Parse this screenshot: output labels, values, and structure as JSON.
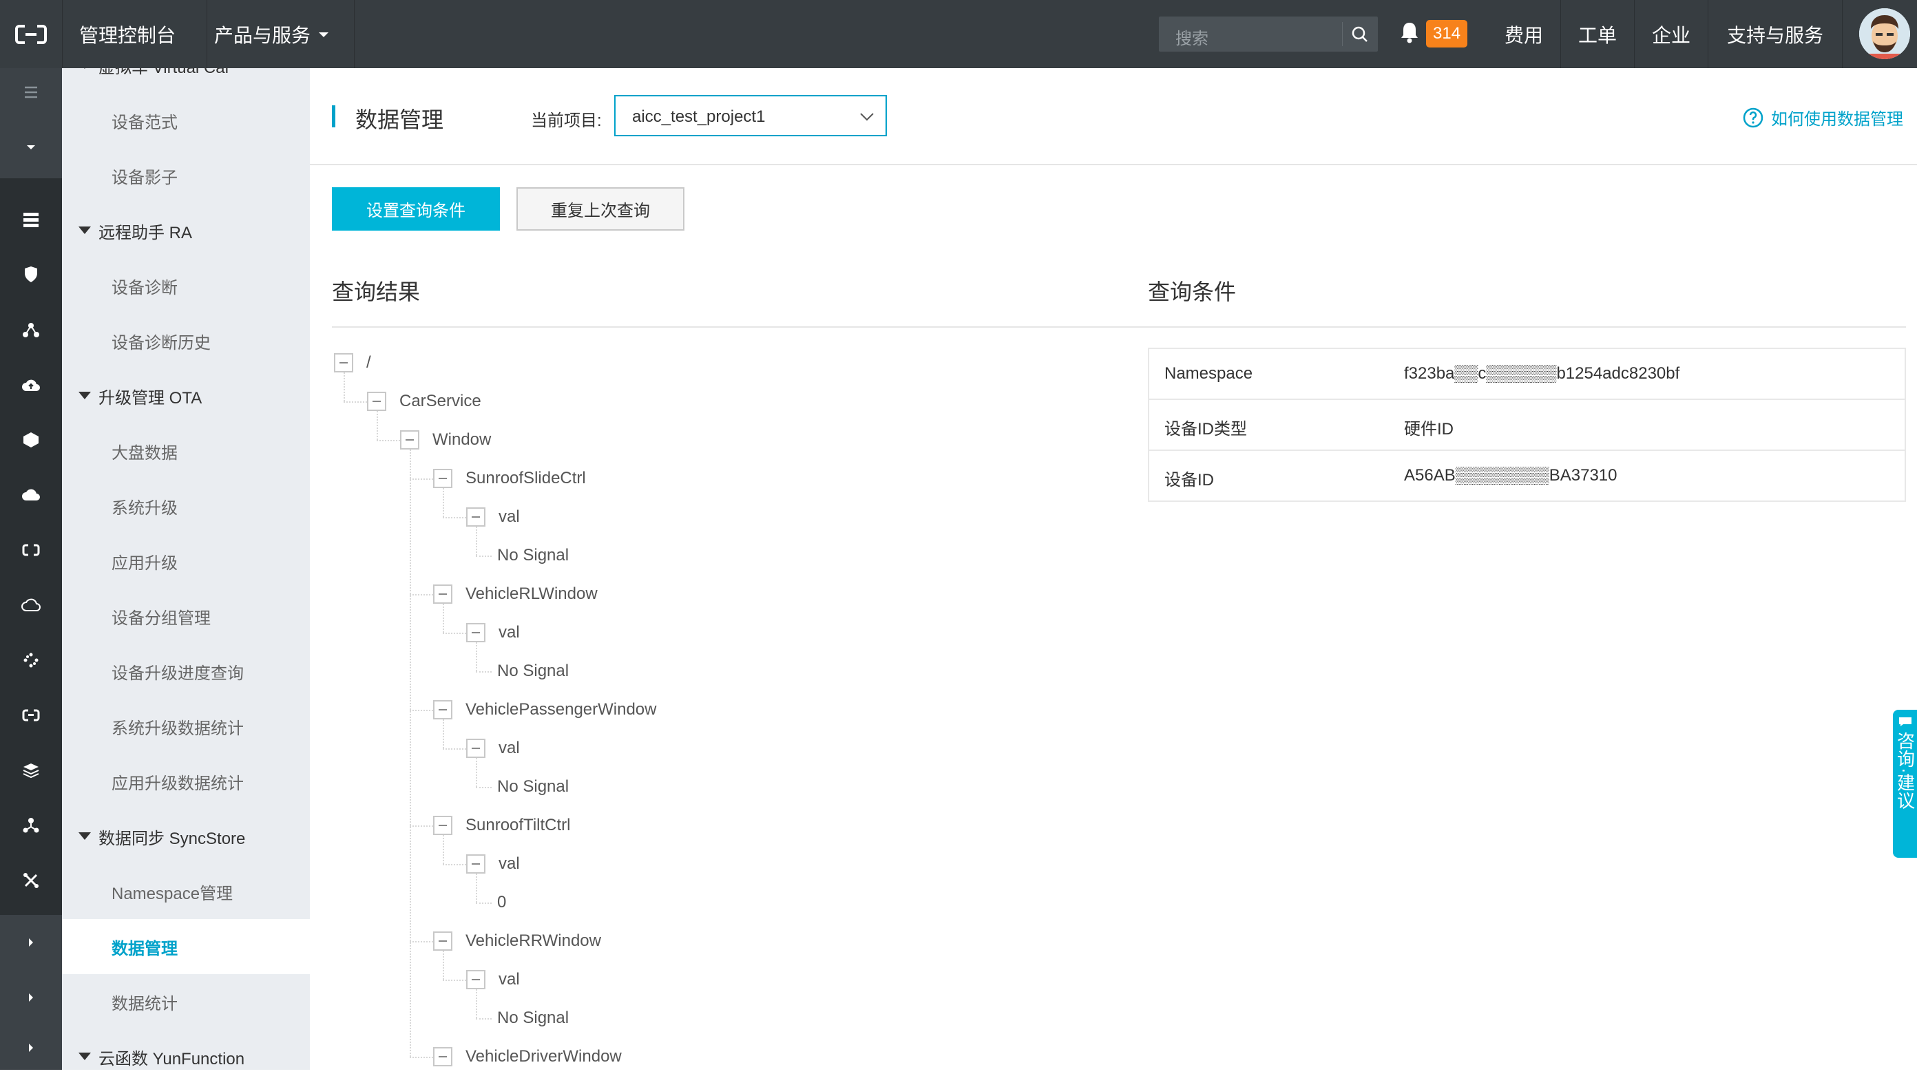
{
  "topbar": {
    "console_label": "管理控制台",
    "products_label": "产品与服务",
    "search_placeholder": "搜索",
    "notification_count": "314",
    "links": [
      "费用",
      "工单",
      "企业",
      "支持与服务"
    ]
  },
  "sidebar": {
    "items": [
      {
        "type": "group",
        "label": "虚拟车 Virtual Car"
      },
      {
        "type": "item",
        "label": "设备范式"
      },
      {
        "type": "item",
        "label": "设备影子"
      },
      {
        "type": "group",
        "label": "远程助手 RA"
      },
      {
        "type": "item",
        "label": "设备诊断"
      },
      {
        "type": "item",
        "label": "设备诊断历史"
      },
      {
        "type": "group",
        "label": "升级管理 OTA"
      },
      {
        "type": "item",
        "label": "大盘数据"
      },
      {
        "type": "item",
        "label": "系统升级"
      },
      {
        "type": "item",
        "label": "应用升级"
      },
      {
        "type": "item",
        "label": "设备分组管理"
      },
      {
        "type": "item",
        "label": "设备升级进度查询"
      },
      {
        "type": "item",
        "label": "系统升级数据统计"
      },
      {
        "type": "item",
        "label": "应用升级数据统计"
      },
      {
        "type": "group",
        "label": "数据同步 SyncStore"
      },
      {
        "type": "item",
        "label": "Namespace管理"
      },
      {
        "type": "item",
        "label": "数据管理",
        "active": true
      },
      {
        "type": "item",
        "label": "数据统计"
      },
      {
        "type": "group",
        "label": "云函数 YunFunction"
      }
    ]
  },
  "page": {
    "title": "数据管理",
    "project_label": "当前项目:",
    "project_value": "aicc_test_project1",
    "help_link": "如何使用数据管理",
    "set_query_button": "设置查询条件",
    "repeat_query_button": "重复上次查询",
    "results_title": "查询结果",
    "conditions_title": "查询条件"
  },
  "tree": [
    {
      "label": "/",
      "depth": 0
    },
    {
      "label": "CarService",
      "depth": 1
    },
    {
      "label": "Window",
      "depth": 2
    },
    {
      "label": "SunroofSlideCtrl",
      "depth": 3
    },
    {
      "label": "val",
      "depth": 4
    },
    {
      "label": "No Signal",
      "depth": 5,
      "leaf": true
    },
    {
      "label": "VehicleRLWindow",
      "depth": 3
    },
    {
      "label": "val",
      "depth": 4
    },
    {
      "label": "No Signal",
      "depth": 5,
      "leaf": true
    },
    {
      "label": "VehiclePassengerWindow",
      "depth": 3
    },
    {
      "label": "val",
      "depth": 4
    },
    {
      "label": "No Signal",
      "depth": 5,
      "leaf": true
    },
    {
      "label": "SunroofTiltCtrl",
      "depth": 3
    },
    {
      "label": "val",
      "depth": 4
    },
    {
      "label": "0",
      "depth": 5,
      "leaf": true
    },
    {
      "label": "VehicleRRWindow",
      "depth": 3
    },
    {
      "label": "val",
      "depth": 4
    },
    {
      "label": "No Signal",
      "depth": 5,
      "leaf": true
    },
    {
      "label": "VehicleDriverWindow",
      "depth": 3
    }
  ],
  "conditions": [
    {
      "key": "Namespace",
      "value": "f323ba▒▒c▒▒▒▒▒▒b1254adc8230bf"
    },
    {
      "key": "设备ID类型",
      "value": "硬件ID"
    },
    {
      "key": "设备ID",
      "value": "A56AB▒▒▒▒▒▒▒▒BA37310"
    }
  ],
  "float_tab": {
    "label": "咨询·建议"
  },
  "colors": {
    "accent": "#00a2ca",
    "topbar": "#373d41",
    "badge": "#f7821b"
  }
}
